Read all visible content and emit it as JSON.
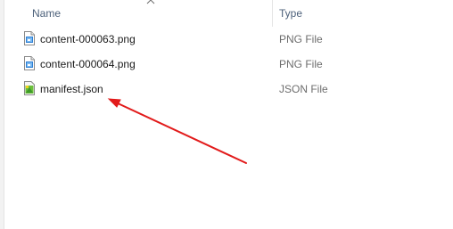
{
  "columns": {
    "name_label": "Name",
    "type_label": "Type"
  },
  "files": [
    {
      "name": "content-000063.png",
      "type": "PNG File",
      "icon": "png-file-icon"
    },
    {
      "name": "content-000064.png",
      "type": "PNG File",
      "icon": "png-file-icon"
    },
    {
      "name": "manifest.json",
      "type": "JSON File",
      "icon": "json-file-icon"
    }
  ],
  "annotation": {
    "color": "#e21b1b",
    "target": "manifest.json"
  }
}
